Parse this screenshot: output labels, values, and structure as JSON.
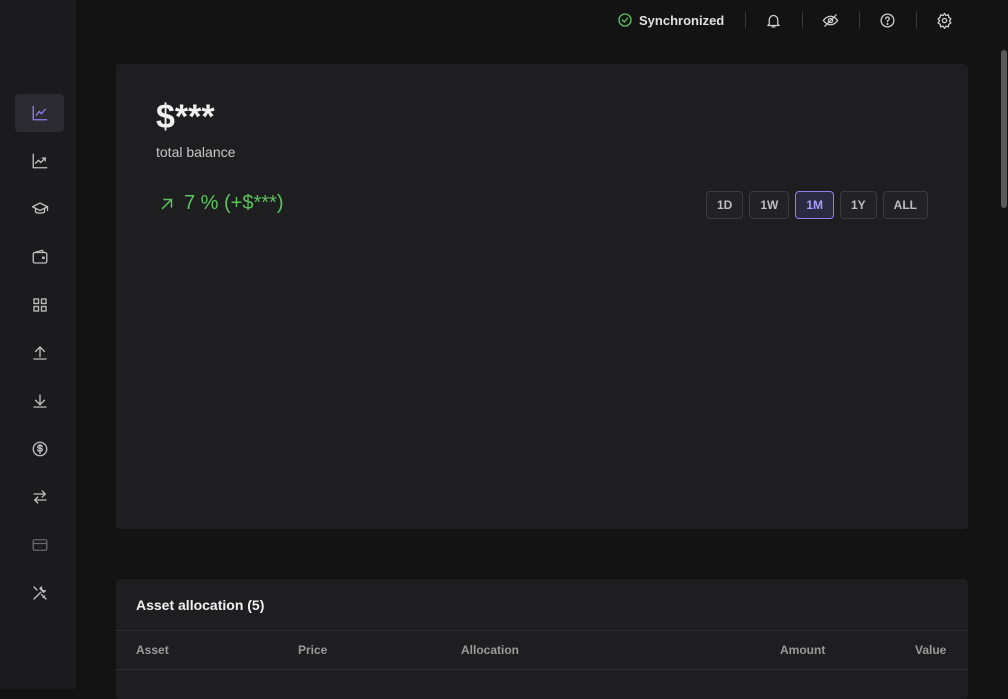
{
  "app": {
    "sync_status": "Synchronized",
    "accent_color": "#8c7ff0",
    "positive_color": "#5cc45c"
  },
  "sidebar": {
    "items": [
      {
        "icon": "line-chart-icon",
        "active": true
      },
      {
        "icon": "trending-chart-icon"
      },
      {
        "icon": "graduation-cap-icon"
      },
      {
        "icon": "wallet-icon"
      },
      {
        "icon": "grid-icon"
      },
      {
        "icon": "upload-icon"
      },
      {
        "icon": "download-icon"
      },
      {
        "icon": "dollar-icon"
      },
      {
        "icon": "swap-icon"
      },
      {
        "icon": "card-icon"
      },
      {
        "icon": "tools-icon"
      }
    ]
  },
  "topbar": {
    "icons": [
      "bell-icon",
      "eye-off-icon",
      "help-icon",
      "gear-icon"
    ]
  },
  "balance": {
    "value": "$***",
    "label": "total balance",
    "change": "7 % (+$***)",
    "ranges": [
      "1D",
      "1W",
      "1M",
      "1Y",
      "ALL"
    ],
    "selected_range": "1M"
  },
  "allocation": {
    "title": "Asset allocation (5)",
    "columns": [
      "Asset",
      "Price",
      "Allocation",
      "Amount",
      "Value"
    ]
  }
}
